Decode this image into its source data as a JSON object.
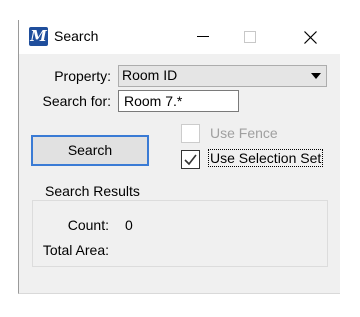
{
  "window": {
    "title": "Search",
    "app_icon_glyph": "M"
  },
  "form": {
    "property_label": "Property:",
    "property_value": "Room ID",
    "search_label": "Search for:",
    "search_value": "Room 7.*"
  },
  "search_button": {
    "label": "Search"
  },
  "options": {
    "use_fence_label": "Use Fence",
    "use_fence_checked": false,
    "use_fence_enabled": false,
    "use_selection_set_label": "Use Selection Set",
    "use_selection_set_checked": true
  },
  "results": {
    "group_title": "Search Results",
    "count_label": "Count:",
    "count_value": "0",
    "total_area_label": "Total Area:",
    "total_area_value": ""
  },
  "icons": {
    "app": "microstation-icon",
    "minimize": "minimize-icon",
    "maximize": "maximize-icon",
    "close": "close-icon",
    "dropdown": "chevron-down-icon",
    "check": "checkmark-icon"
  },
  "colors": {
    "dialog_bg": "#f0f0f0",
    "focus_border": "#3a7bd5",
    "app_icon": "#1f4e9c"
  }
}
